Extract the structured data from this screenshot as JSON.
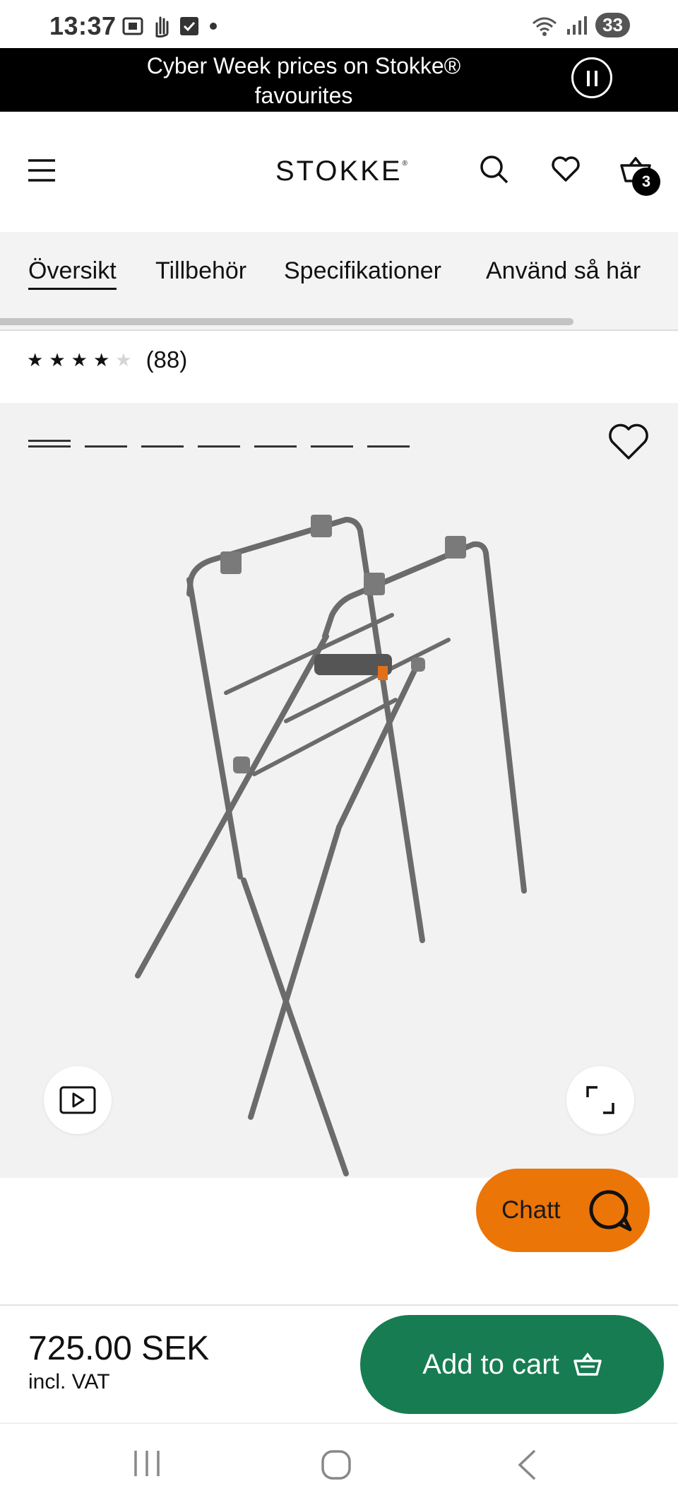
{
  "status_bar": {
    "time": "13:37",
    "battery": "33",
    "icons_left": [
      "screenshot-icon",
      "hand-icon",
      "check-icon",
      "dot-icon"
    ],
    "icons_right": [
      "wifi-icon",
      "signal-icon"
    ]
  },
  "promo_banner": {
    "text": "Cyber Week prices on Stokke® favourites"
  },
  "header": {
    "brand": "STOKKE",
    "brand_mark": "®",
    "cart_count": "3"
  },
  "tabs": [
    {
      "label": "Översikt",
      "active": true
    },
    {
      "label": "Tillbehör",
      "active": false
    },
    {
      "label": "Specifikationer",
      "active": false
    },
    {
      "label": "Använd så här",
      "active": false
    }
  ],
  "rating": {
    "stars": 4,
    "max": 5,
    "count": "(88)"
  },
  "gallery": {
    "slides": 7,
    "active_slide": 1,
    "product": "folding stand"
  },
  "chat": {
    "label": "Chatt"
  },
  "purchase_bar": {
    "price": "725.00 SEK",
    "vat_note": "incl. VAT",
    "add_to_cart": "Add to cart"
  },
  "colors": {
    "promo_bg": "#000000",
    "chat_orange": "#ec7508",
    "cart_green": "#177c52",
    "gallery_bg": "#f2f2f2"
  }
}
